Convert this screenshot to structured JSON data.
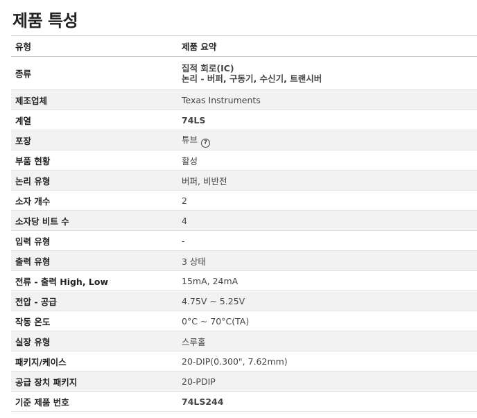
{
  "title": "제품 특성",
  "header": {
    "attr": "유형",
    "value": "제품 요약"
  },
  "rows": [
    {
      "label": "종류",
      "line1": "집적 회로(IC)",
      "line2": "논리 - 버퍼, 구동기, 수신기, 트랜시버"
    },
    {
      "label": "제조업체",
      "value": "Texas Instruments"
    },
    {
      "label": "계열",
      "value": "74LS"
    },
    {
      "label": "포장",
      "value": "튜브",
      "help": "?"
    },
    {
      "label": "부품 현황",
      "value": "활성"
    },
    {
      "label": "논리 유형",
      "value": "버퍼, 비반전"
    },
    {
      "label": "소자 개수",
      "value": "2"
    },
    {
      "label": "소자당 비트 수",
      "value": "4"
    },
    {
      "label": "입력 유형",
      "value": "-"
    },
    {
      "label": "출력 유형",
      "value": "3 상태"
    },
    {
      "label": "전류 - 출력 High, Low",
      "value": "15mA, 24mA"
    },
    {
      "label": "전압 - 공급",
      "value": "4.75V ~ 5.25V"
    },
    {
      "label": "작동 온도",
      "value": "0°C ~ 70°C(TA)"
    },
    {
      "label": "실장 유형",
      "value": "스루홀"
    },
    {
      "label": "패키지/케이스",
      "value": "20-DIP(0.300\", 7.62mm)"
    },
    {
      "label": "공급 장치 패키지",
      "value": "20-PDIP"
    },
    {
      "label": "기준 제품 번호",
      "value": "74LS244"
    }
  ],
  "colors": {
    "link": "#1f2d94",
    "alt_row": "#f2f2f2"
  }
}
